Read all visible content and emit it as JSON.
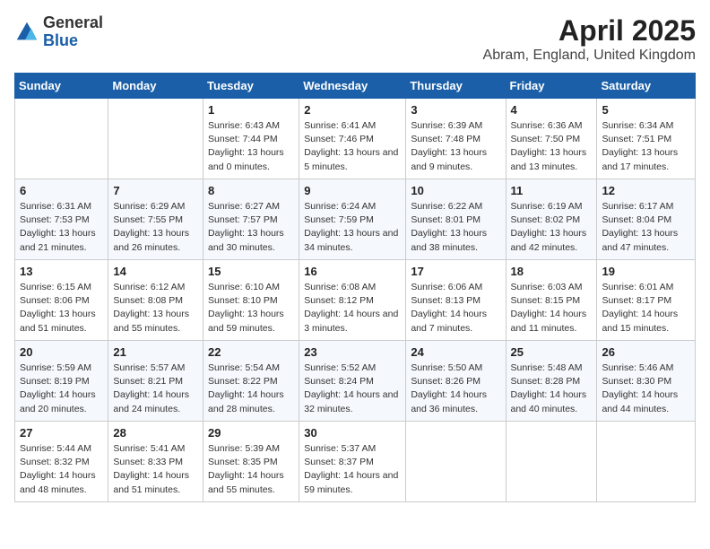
{
  "logo": {
    "text_general": "General",
    "text_blue": "Blue"
  },
  "title": "April 2025",
  "subtitle": "Abram, England, United Kingdom",
  "days_of_week": [
    "Sunday",
    "Monday",
    "Tuesday",
    "Wednesday",
    "Thursday",
    "Friday",
    "Saturday"
  ],
  "weeks": [
    [
      {
        "day": "",
        "sunrise": "",
        "sunset": "",
        "daylight": ""
      },
      {
        "day": "",
        "sunrise": "",
        "sunset": "",
        "daylight": ""
      },
      {
        "day": "1",
        "sunrise": "Sunrise: 6:43 AM",
        "sunset": "Sunset: 7:44 PM",
        "daylight": "Daylight: 13 hours and 0 minutes."
      },
      {
        "day": "2",
        "sunrise": "Sunrise: 6:41 AM",
        "sunset": "Sunset: 7:46 PM",
        "daylight": "Daylight: 13 hours and 5 minutes."
      },
      {
        "day": "3",
        "sunrise": "Sunrise: 6:39 AM",
        "sunset": "Sunset: 7:48 PM",
        "daylight": "Daylight: 13 hours and 9 minutes."
      },
      {
        "day": "4",
        "sunrise": "Sunrise: 6:36 AM",
        "sunset": "Sunset: 7:50 PM",
        "daylight": "Daylight: 13 hours and 13 minutes."
      },
      {
        "day": "5",
        "sunrise": "Sunrise: 6:34 AM",
        "sunset": "Sunset: 7:51 PM",
        "daylight": "Daylight: 13 hours and 17 minutes."
      }
    ],
    [
      {
        "day": "6",
        "sunrise": "Sunrise: 6:31 AM",
        "sunset": "Sunset: 7:53 PM",
        "daylight": "Daylight: 13 hours and 21 minutes."
      },
      {
        "day": "7",
        "sunrise": "Sunrise: 6:29 AM",
        "sunset": "Sunset: 7:55 PM",
        "daylight": "Daylight: 13 hours and 26 minutes."
      },
      {
        "day": "8",
        "sunrise": "Sunrise: 6:27 AM",
        "sunset": "Sunset: 7:57 PM",
        "daylight": "Daylight: 13 hours and 30 minutes."
      },
      {
        "day": "9",
        "sunrise": "Sunrise: 6:24 AM",
        "sunset": "Sunset: 7:59 PM",
        "daylight": "Daylight: 13 hours and 34 minutes."
      },
      {
        "day": "10",
        "sunrise": "Sunrise: 6:22 AM",
        "sunset": "Sunset: 8:01 PM",
        "daylight": "Daylight: 13 hours and 38 minutes."
      },
      {
        "day": "11",
        "sunrise": "Sunrise: 6:19 AM",
        "sunset": "Sunset: 8:02 PM",
        "daylight": "Daylight: 13 hours and 42 minutes."
      },
      {
        "day": "12",
        "sunrise": "Sunrise: 6:17 AM",
        "sunset": "Sunset: 8:04 PM",
        "daylight": "Daylight: 13 hours and 47 minutes."
      }
    ],
    [
      {
        "day": "13",
        "sunrise": "Sunrise: 6:15 AM",
        "sunset": "Sunset: 8:06 PM",
        "daylight": "Daylight: 13 hours and 51 minutes."
      },
      {
        "day": "14",
        "sunrise": "Sunrise: 6:12 AM",
        "sunset": "Sunset: 8:08 PM",
        "daylight": "Daylight: 13 hours and 55 minutes."
      },
      {
        "day": "15",
        "sunrise": "Sunrise: 6:10 AM",
        "sunset": "Sunset: 8:10 PM",
        "daylight": "Daylight: 13 hours and 59 minutes."
      },
      {
        "day": "16",
        "sunrise": "Sunrise: 6:08 AM",
        "sunset": "Sunset: 8:12 PM",
        "daylight": "Daylight: 14 hours and 3 minutes."
      },
      {
        "day": "17",
        "sunrise": "Sunrise: 6:06 AM",
        "sunset": "Sunset: 8:13 PM",
        "daylight": "Daylight: 14 hours and 7 minutes."
      },
      {
        "day": "18",
        "sunrise": "Sunrise: 6:03 AM",
        "sunset": "Sunset: 8:15 PM",
        "daylight": "Daylight: 14 hours and 11 minutes."
      },
      {
        "day": "19",
        "sunrise": "Sunrise: 6:01 AM",
        "sunset": "Sunset: 8:17 PM",
        "daylight": "Daylight: 14 hours and 15 minutes."
      }
    ],
    [
      {
        "day": "20",
        "sunrise": "Sunrise: 5:59 AM",
        "sunset": "Sunset: 8:19 PM",
        "daylight": "Daylight: 14 hours and 20 minutes."
      },
      {
        "day": "21",
        "sunrise": "Sunrise: 5:57 AM",
        "sunset": "Sunset: 8:21 PM",
        "daylight": "Daylight: 14 hours and 24 minutes."
      },
      {
        "day": "22",
        "sunrise": "Sunrise: 5:54 AM",
        "sunset": "Sunset: 8:22 PM",
        "daylight": "Daylight: 14 hours and 28 minutes."
      },
      {
        "day": "23",
        "sunrise": "Sunrise: 5:52 AM",
        "sunset": "Sunset: 8:24 PM",
        "daylight": "Daylight: 14 hours and 32 minutes."
      },
      {
        "day": "24",
        "sunrise": "Sunrise: 5:50 AM",
        "sunset": "Sunset: 8:26 PM",
        "daylight": "Daylight: 14 hours and 36 minutes."
      },
      {
        "day": "25",
        "sunrise": "Sunrise: 5:48 AM",
        "sunset": "Sunset: 8:28 PM",
        "daylight": "Daylight: 14 hours and 40 minutes."
      },
      {
        "day": "26",
        "sunrise": "Sunrise: 5:46 AM",
        "sunset": "Sunset: 8:30 PM",
        "daylight": "Daylight: 14 hours and 44 minutes."
      }
    ],
    [
      {
        "day": "27",
        "sunrise": "Sunrise: 5:44 AM",
        "sunset": "Sunset: 8:32 PM",
        "daylight": "Daylight: 14 hours and 48 minutes."
      },
      {
        "day": "28",
        "sunrise": "Sunrise: 5:41 AM",
        "sunset": "Sunset: 8:33 PM",
        "daylight": "Daylight: 14 hours and 51 minutes."
      },
      {
        "day": "29",
        "sunrise": "Sunrise: 5:39 AM",
        "sunset": "Sunset: 8:35 PM",
        "daylight": "Daylight: 14 hours and 55 minutes."
      },
      {
        "day": "30",
        "sunrise": "Sunrise: 5:37 AM",
        "sunset": "Sunset: 8:37 PM",
        "daylight": "Daylight: 14 hours and 59 minutes."
      },
      {
        "day": "",
        "sunrise": "",
        "sunset": "",
        "daylight": ""
      },
      {
        "day": "",
        "sunrise": "",
        "sunset": "",
        "daylight": ""
      },
      {
        "day": "",
        "sunrise": "",
        "sunset": "",
        "daylight": ""
      }
    ]
  ]
}
